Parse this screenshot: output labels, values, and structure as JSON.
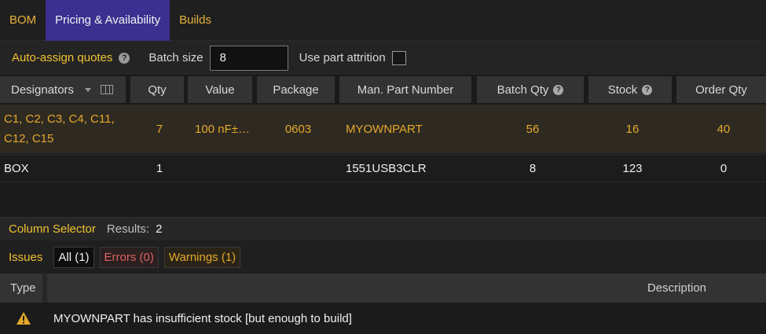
{
  "tabs": [
    {
      "label": "BOM"
    },
    {
      "label": "Pricing & Availability"
    },
    {
      "label": "Builds"
    }
  ],
  "toolbar": {
    "auto_assign": "Auto-assign quotes",
    "batch_size_label": "Batch size",
    "batch_size_value": "8",
    "use_attrition_label": "Use part attrition"
  },
  "columns": {
    "designators": "Designators",
    "qty": "Qty",
    "value": "Value",
    "package": "Package",
    "mpn": "Man. Part Number",
    "batch_qty": "Batch Qty",
    "stock": "Stock",
    "order_qty": "Order Qty"
  },
  "rows": [
    {
      "designators": "C1, C2, C3, C4, C11, C12, C15",
      "qty": "7",
      "value": "100 nF±…",
      "package": "0603",
      "mpn": "MYOWNPART",
      "batch_qty": "56",
      "stock": "16",
      "order_qty": "40"
    },
    {
      "designators": "BOX",
      "qty": "1",
      "value": "",
      "package": "",
      "mpn": "1551USB3CLR",
      "batch_qty": "8",
      "stock": "123",
      "order_qty": "0"
    }
  ],
  "column_selector": {
    "label": "Column Selector",
    "results_label": "Results:",
    "results_value": "2"
  },
  "issues": {
    "label": "Issues",
    "filters": {
      "all": "All (1)",
      "errors": "Errors (0)",
      "warnings": "Warnings (1)"
    },
    "headers": {
      "type": "Type",
      "description": "Description"
    },
    "items": [
      {
        "type_icon": "warning-icon",
        "description": "MYOWNPART has insufficient stock [but enough to build]"
      }
    ]
  },
  "colors": {
    "accent_gold": "#f0c232",
    "active_tab": "#3b2f8f",
    "row_highlight_text": "#e5a82a",
    "error_red": "#e06060"
  }
}
